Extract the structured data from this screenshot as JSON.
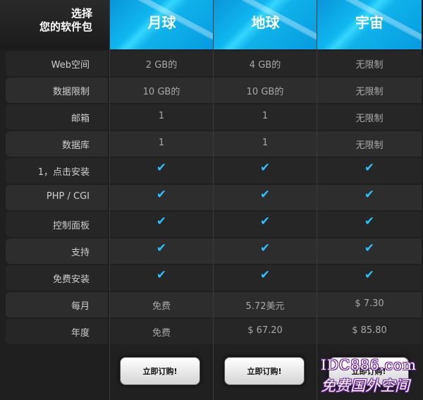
{
  "header": {
    "corner_line1": "选择",
    "corner_line2": "您的软件包"
  },
  "plans": [
    {
      "name": "月球",
      "button": "立即订购!"
    },
    {
      "name": "地球",
      "button": "立即订购!"
    },
    {
      "name": "宇宙",
      "button": "立即订购!"
    }
  ],
  "rows": [
    {
      "label": "Web空间",
      "values": [
        "2 GB的",
        "4 GB的",
        "无限制"
      ]
    },
    {
      "label": "数据限制",
      "values": [
        "10 GB的",
        "10 GB的",
        "无限制"
      ]
    },
    {
      "label": "邮箱",
      "values": [
        "1",
        "1",
        "无限制"
      ]
    },
    {
      "label": "数据库",
      "values": [
        "1",
        "1",
        "无限制"
      ]
    },
    {
      "label": "1，点击安装",
      "values": [
        "✔",
        "✔",
        "✔"
      ]
    },
    {
      "label": "PHP / CGI",
      "values": [
        "✔",
        "✔",
        "✔"
      ]
    },
    {
      "label": "控制面板",
      "values": [
        "✔",
        "✔",
        "✔"
      ]
    },
    {
      "label": "支持",
      "values": [
        "✔",
        "✔",
        "✔"
      ]
    },
    {
      "label": "免费安装",
      "values": [
        "✔",
        "✔",
        "✔"
      ]
    },
    {
      "label": "每月",
      "values": [
        "免费",
        "5.72美元",
        "$ 7.30"
      ]
    },
    {
      "label": "年度",
      "values": [
        "免费",
        "$ 67.20",
        "$ 85.80"
      ]
    }
  ],
  "watermark": {
    "line1": "IDC886.com",
    "line2": "免费国外空间"
  },
  "colors": {
    "accent": "#0fb6ef",
    "check": "#2bc2ff"
  }
}
